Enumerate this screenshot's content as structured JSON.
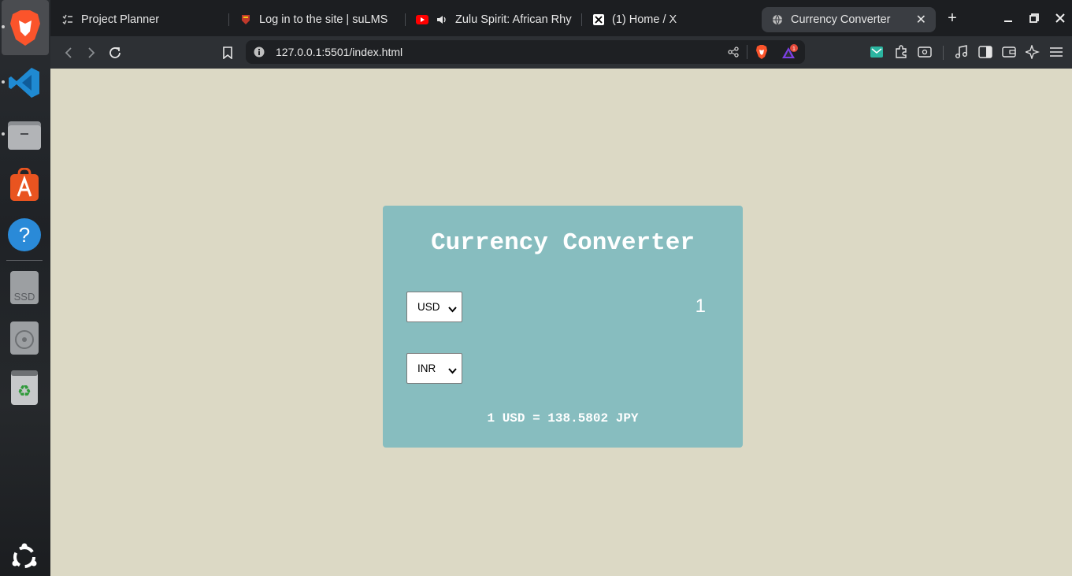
{
  "browser": {
    "tabs": [
      {
        "label": "Project Planner",
        "icon": "checklist-icon"
      },
      {
        "label": "Log in to the site | suLMS",
        "icon": "shield-crest-icon"
      },
      {
        "label": "Zulu Spirit: African Rhyt",
        "icon": "youtube-icon"
      },
      {
        "label": "(1) Home / X",
        "icon": "x-logo-icon"
      },
      {
        "label": "Currency Converter",
        "icon": "globe-icon",
        "active": true
      }
    ],
    "url": "127.0.0.1:5501/index.html",
    "rewards_badge": "1"
  },
  "dock": {
    "items": [
      "brave-browser",
      "vscode",
      "files",
      "app-center",
      "help",
      "ssd-drive",
      "optical-drive",
      "trash",
      "show-apps"
    ],
    "ssd_label": "SSD"
  },
  "converter": {
    "title": "Currency Converter",
    "from_currency": "USD",
    "to_currency": "INR",
    "amount": "1",
    "rate_text": "1 USD = 138.5802 JPY"
  },
  "colors": {
    "page_bg": "#dcd9c5",
    "card_bg": "#87bdbf",
    "card_text": "#ffffff",
    "browser_tabbar": "#1c1e21",
    "browser_toolbar": "#2d3034"
  }
}
